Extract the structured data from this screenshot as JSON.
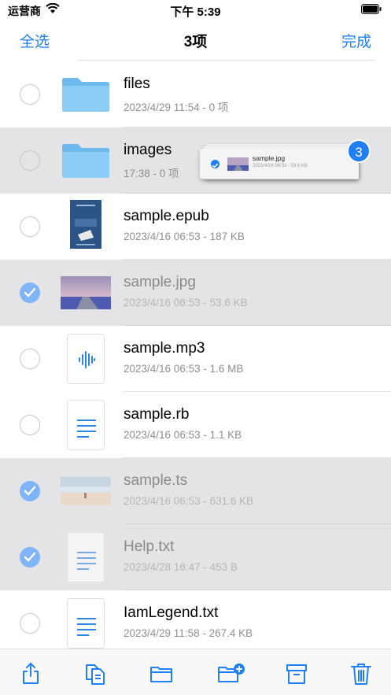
{
  "status": {
    "carrier": "运营商",
    "time": "下午 5:39"
  },
  "nav": {
    "select_all": "全选",
    "title": "3项",
    "done": "完成"
  },
  "files": [
    {
      "name": "files",
      "meta": "2023/4/29 11:54 - 0 项",
      "kind": "folder",
      "selected": false
    },
    {
      "name": "images",
      "meta": "17:38 - 0 项",
      "kind": "folder",
      "selected": false,
      "drop_target": true
    },
    {
      "name": "sample.epub",
      "meta": "2023/4/16 06:53 - 187 KB",
      "kind": "epub",
      "selected": false
    },
    {
      "name": "sample.jpg",
      "meta": "2023/4/16 06:53 - 53.6 KB",
      "kind": "image",
      "selected": true
    },
    {
      "name": "sample.mp3",
      "meta": "2023/4/16 06:53 - 1.6 MB",
      "kind": "audio",
      "selected": false
    },
    {
      "name": "sample.rb",
      "meta": "2023/4/16 06:53 - 1.1 KB",
      "kind": "text",
      "selected": false
    },
    {
      "name": "sample.ts",
      "meta": "2023/4/16 06:53 - 631.6 KB",
      "kind": "video",
      "selected": true
    },
    {
      "name": "Help.txt",
      "meta": "2023/4/28 16:47 - 453 B",
      "kind": "text",
      "selected": true
    },
    {
      "name": "IamLegend.txt",
      "meta": "2023/4/29 11:58 - 267.4 KB",
      "kind": "text",
      "selected": false
    }
  ],
  "drag": {
    "count": "3",
    "name": "sample.jpg",
    "meta": "2023/4/16 06:53 - 53.6 KB"
  },
  "toolbar": {
    "icons": [
      "share-icon",
      "copy-icon",
      "move-to-folder-icon",
      "new-folder-icon",
      "archive-icon",
      "trash-icon"
    ]
  },
  "colors": {
    "accent": "#1f7ff4",
    "selected_check": "#7fb5f6",
    "selected_row": "#e4e4e6",
    "folder": "#7dc3f4"
  }
}
